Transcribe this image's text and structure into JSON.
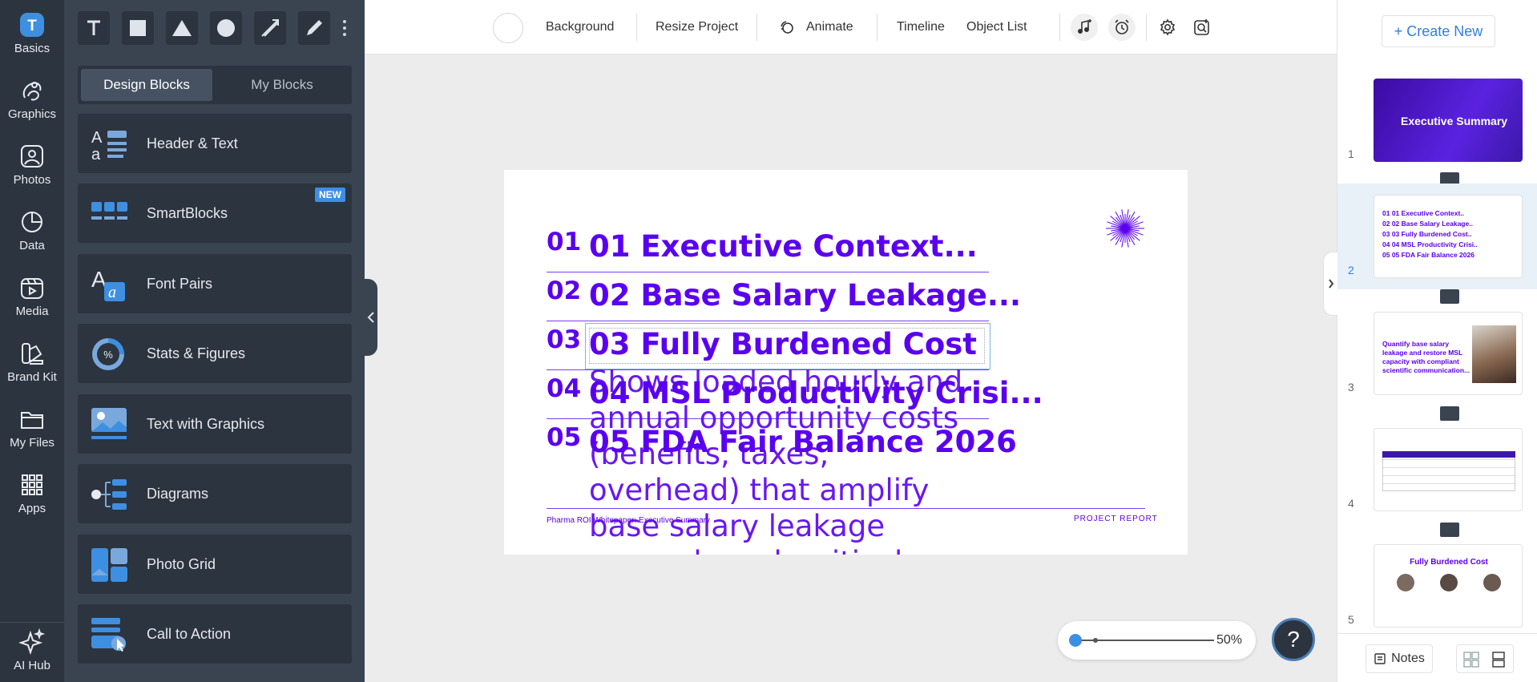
{
  "rail": {
    "items": [
      {
        "label": "Basics",
        "icon": "basics-icon"
      },
      {
        "label": "Graphics",
        "icon": "graphics-icon"
      },
      {
        "label": "Photos",
        "icon": "photos-icon"
      },
      {
        "label": "Data",
        "icon": "data-icon"
      },
      {
        "label": "Media",
        "icon": "media-icon"
      },
      {
        "label": "Brand Kit",
        "icon": "brand-kit-icon"
      },
      {
        "label": "My Files",
        "icon": "folder-icon"
      },
      {
        "label": "Apps",
        "icon": "apps-icon"
      }
    ],
    "ai_hub": "AI Hub"
  },
  "panel": {
    "tabs": [
      "Design Blocks",
      "My Blocks"
    ],
    "blocks": [
      {
        "label": "Header & Text",
        "icon": "header-text-icon"
      },
      {
        "label": "SmartBlocks",
        "icon": "smartblocks-icon",
        "badge": "NEW"
      },
      {
        "label": "Font Pairs",
        "icon": "font-pairs-icon"
      },
      {
        "label": "Stats & Figures",
        "icon": "stats-icon"
      },
      {
        "label": "Text with Graphics",
        "icon": "text-graphics-icon"
      },
      {
        "label": "Diagrams",
        "icon": "diagrams-icon"
      },
      {
        "label": "Photo Grid",
        "icon": "photo-grid-icon"
      },
      {
        "label": "Call to Action",
        "icon": "call-to-action-icon"
      }
    ]
  },
  "toolbar": {
    "background": "Background",
    "resize": "Resize Project",
    "animate": "Animate",
    "timeline": "Timeline",
    "object_list": "Object List"
  },
  "slide": {
    "rows": [
      {
        "num": "01",
        "title": "01 Executive Context..."
      },
      {
        "num": "02",
        "title": "02 Base Salary Leakage..."
      },
      {
        "num": "03",
        "title": "03 Fully Burdened Cost"
      },
      {
        "num": "04",
        "title": "04 MSL Productivity Crisi..."
      },
      {
        "num": "05",
        "title": "05 FDA Fair Balance 2026"
      }
    ],
    "body_text": "Shows loaded hourly and annual opportunity costs (benefits, taxes, overhead) that amplify base salary leakage across launch-critical",
    "footer_left": "Pharma ROI Whitepaper: Executive Summary",
    "footer_right": "PROJECT REPORT",
    "accent": "#5a00f0"
  },
  "zoom": {
    "level": "50%",
    "fraction": 0.0
  },
  "help": "?",
  "pages": {
    "create_new": "+ Create New",
    "thumbs": [
      {
        "num": "1",
        "title": "Executive Summary"
      },
      {
        "num": "2",
        "lines": [
          "01 01 Executive Context..",
          "02 02 Base Salary Leakage..",
          "03 03 Fully Burdened Cost..",
          "04 04 MSL Productivity Crisi..",
          "05 05 FDA Fair Balance 2026"
        ]
      },
      {
        "num": "3",
        "text": "Quantify base salary leakage and restore MSL capacity with compliant scientific communication..."
      },
      {
        "num": "4"
      },
      {
        "num": "5",
        "title": "Fully Burdened Cost"
      }
    ],
    "notes": "Notes"
  }
}
